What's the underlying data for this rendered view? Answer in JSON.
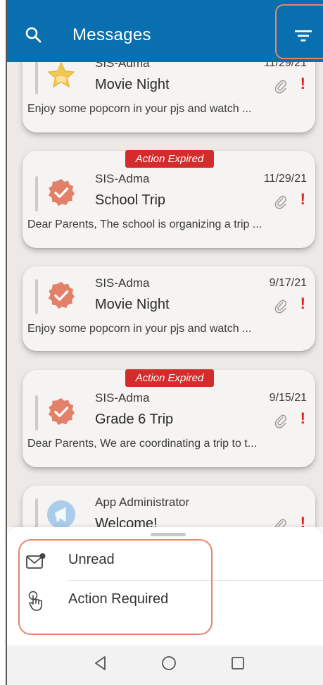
{
  "header": {
    "title": "Messages"
  },
  "messages": [
    {
      "sender": "SIS-Adma",
      "date": "11/29/21",
      "subject": "Movie Night",
      "preview": "Enjoy some popcorn in your pjs and watch ...",
      "attachment": true,
      "important": "!",
      "badge": "",
      "avatar": "star-icon"
    },
    {
      "sender": "SIS-Adma",
      "date": "11/29/21",
      "subject": "School Trip",
      "preview": "Dear Parents, The school is organizing a trip ...",
      "attachment": true,
      "important": "!",
      "badge": "Action Expired",
      "avatar": "verified-check-icon"
    },
    {
      "sender": "SIS-Adma",
      "date": "9/17/21",
      "subject": "Movie Night",
      "preview": "Enjoy some popcorn in your pjs and watch ...",
      "attachment": true,
      "important": "!",
      "badge": "",
      "avatar": "verified-check-icon"
    },
    {
      "sender": "SIS-Adma",
      "date": "9/15/21",
      "subject": "Grade 6 Trip",
      "preview": "Dear Parents, We are coordinating a trip to t...",
      "attachment": true,
      "important": "!",
      "badge": "Action Expired",
      "avatar": "verified-check-icon"
    },
    {
      "sender": "App Administrator",
      "date": "",
      "subject": "Welcome!",
      "preview": "",
      "attachment": true,
      "important": "!",
      "badge": "",
      "avatar": "megaphone-icon"
    }
  ],
  "filter_sheet": {
    "options": [
      {
        "label": "Unread",
        "icon": "unread-envelope-icon"
      },
      {
        "label": "Action Required",
        "icon": "touch-hand-icon"
      }
    ]
  },
  "colors": {
    "appbar": "#0a6faf",
    "badge": "#d42b2b",
    "highlight": "#e8846a",
    "alert": "#e02020",
    "list_bg": "#ece9e6"
  }
}
